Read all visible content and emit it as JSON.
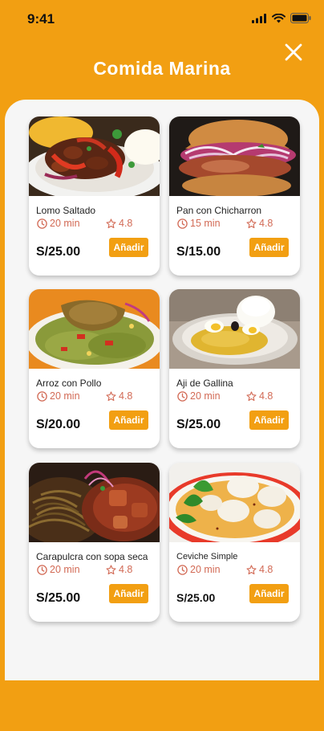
{
  "status_bar": {
    "time": "9:41"
  },
  "header": {
    "title": "Comida Marina"
  },
  "button_label": "Añadir",
  "colors": {
    "accent": "#F29F12",
    "meta": "#D26A55"
  },
  "icons": {
    "close": "close-icon",
    "time": "clock-icon",
    "rating": "star-icon"
  },
  "items": [
    {
      "name": "Lomo Saltado",
      "time": "20 min",
      "rating": "4.8",
      "price": "S/25.00"
    },
    {
      "name": "Pan con Chicharron",
      "time": "15 min",
      "rating": "4.8",
      "price": "S/15.00"
    },
    {
      "name": "Arroz con Pollo",
      "time": "20 min",
      "rating": "4.8",
      "price": "S/20.00"
    },
    {
      "name": "Aji de Gallina",
      "time": "20 min",
      "rating": "4.8",
      "price": "S/25.00"
    },
    {
      "name": "Carapulcra con sopa seca",
      "time": "20 min",
      "rating": "4.8",
      "price": "S/25.00"
    },
    {
      "name": "Ceviche Simple",
      "time": "20 min",
      "rating": "4.8",
      "price": "S/25.00"
    }
  ]
}
